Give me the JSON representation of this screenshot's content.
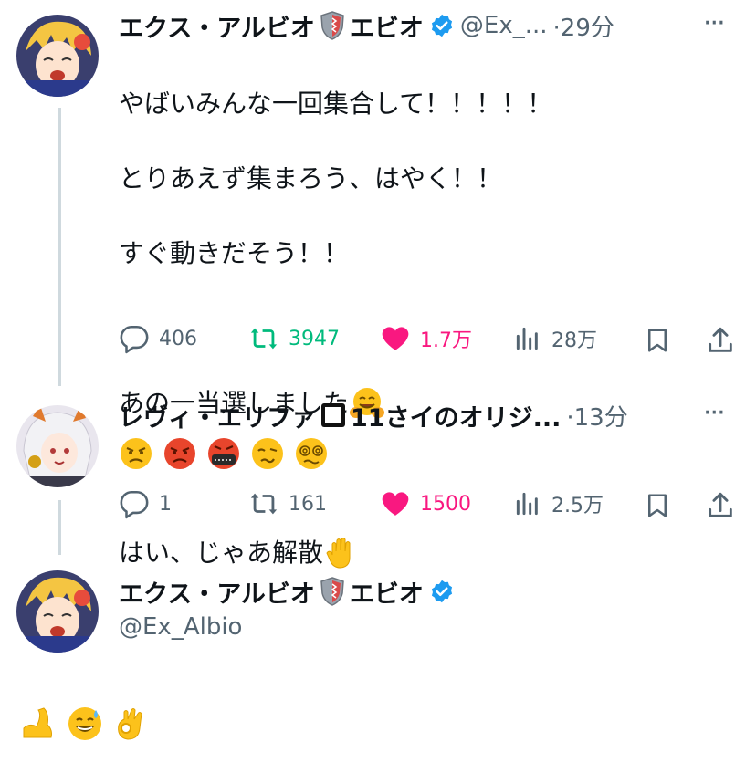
{
  "tweet1": {
    "name": "エクス・アルビオ",
    "name_suffix": "エビオ",
    "handle": "@Ex_...",
    "time": "·29分",
    "lines": [
      "やばいみんな一回集合して！！！！！",
      "とりあえず集まろう、はやく！！",
      "すぐ動きだそう！！",
      "",
      "あの一当選しました",
      "",
      "はい、じゃあ解散"
    ],
    "replies": "406",
    "retweets": "3947",
    "likes": "1.7万",
    "views": "28万",
    "retweet_color": "#00ba7c",
    "like_color": "#f91880"
  },
  "tweet2": {
    "name": "レヴィ・エリファ",
    "name_suffix": "11さイのオリジ...",
    "time": "·13分",
    "replies": "1",
    "retweets": "161",
    "likes": "1500",
    "views": "2.5万"
  },
  "tweet3": {
    "name": "エクス・アルビオ",
    "name_suffix": "エビオ",
    "handle": "@Ex_Albio"
  },
  "more_label": "···",
  "verified_color": "#1d9bf0"
}
